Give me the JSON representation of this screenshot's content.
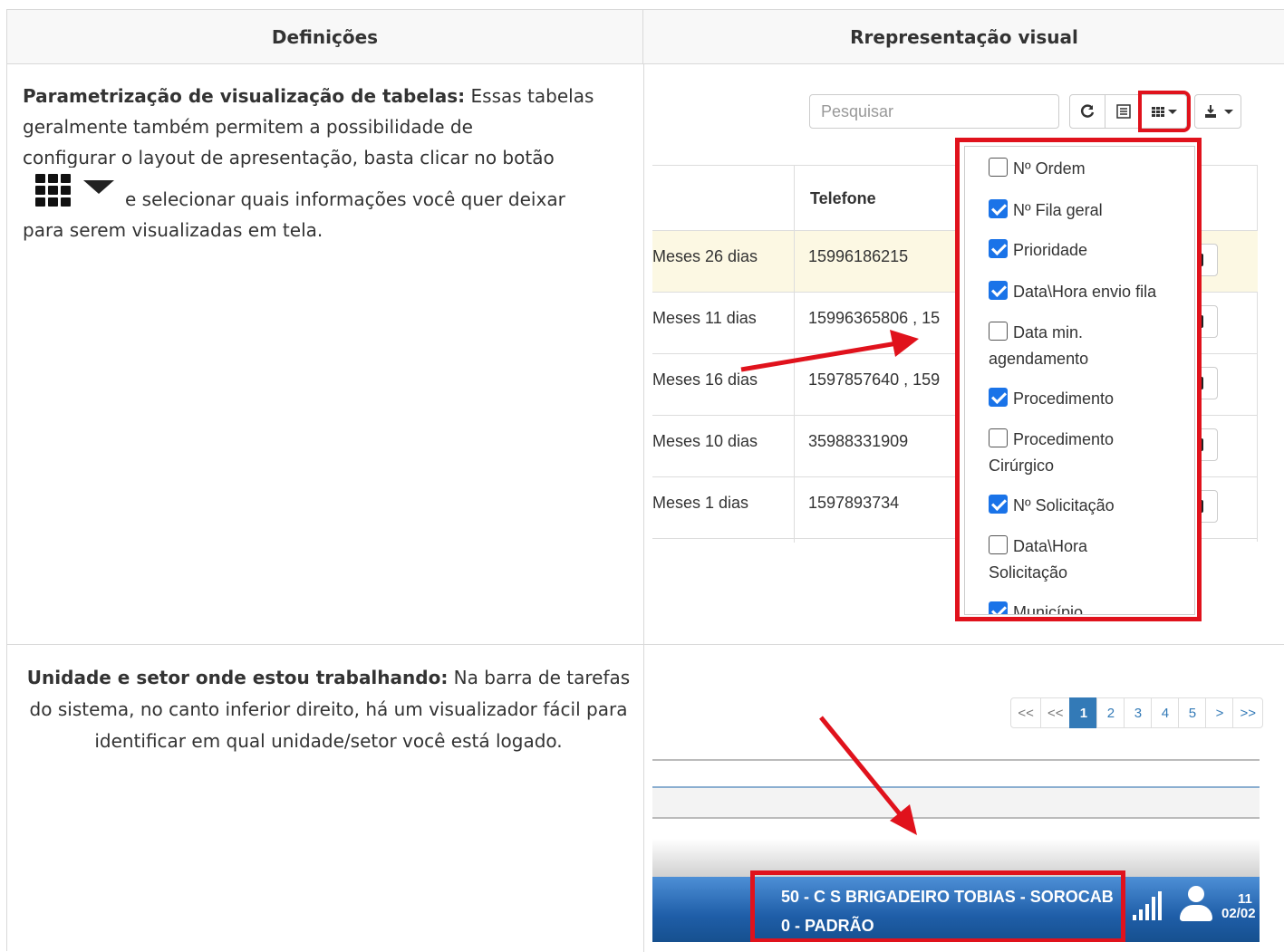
{
  "headers": {
    "definitions": "Definições",
    "visual": "Rrepresentação visual"
  },
  "row1": {
    "bold_title": "Parametrização de visualização de tabelas:",
    "text_a": " Essas tabelas geralmente também permitem a possibilidade de",
    "text_clipped": "configurar o layout de apresentação, basta clicar no botão",
    "text_b": "e selecionar quais informações você quer deixar",
    "text_c": "para serem visualizadas em tela.",
    "search_placeholder": "Pesquisar",
    "table": {
      "column_header": "Telefone",
      "rows": [
        {
          "c1": "Meses 26 dias",
          "c2": "15996186215",
          "highlight": true
        },
        {
          "c1": "Meses 11 dias",
          "c2": "15996365806 , 15",
          "highlight": false
        },
        {
          "c1": "Meses 16 dias",
          "c2": "1597857640 , 159",
          "highlight": false
        },
        {
          "c1": "Meses 10 dias",
          "c2": "35988331909",
          "highlight": false
        },
        {
          "c1": "Meses 1 dias",
          "c2": "1597893734",
          "highlight": false
        }
      ]
    },
    "column_options": [
      {
        "label": "Nº Ordem",
        "checked": false
      },
      {
        "label": "Nº Fila geral",
        "checked": true
      },
      {
        "label": "Prioridade",
        "checked": true
      },
      {
        "label": "Data\\Hora envio fila",
        "checked": true
      },
      {
        "label": "Data min.",
        "label2": "agendamento",
        "checked": false
      },
      {
        "label": "Procedimento",
        "checked": true
      },
      {
        "label": "Procedimento",
        "label2": "Cirúrgico",
        "checked": false
      },
      {
        "label": "Nº Solicitação",
        "checked": true
      },
      {
        "label": "Data\\Hora",
        "label2": "Solicitação",
        "checked": false
      },
      {
        "label": "Município",
        "checked": true
      }
    ],
    "icons": [
      "refresh-icon",
      "list-icon",
      "columns-grid-icon",
      "export-icon"
    ],
    "highlight_color": "#e0121c"
  },
  "row2": {
    "bold_title": "Unidade e setor onde estou trabalhando:",
    "text": " Na barra de tarefas do sistema, no canto inferior direito, há um visualizador fácil para identificar em qual unidade/setor você está logado.",
    "pagination": [
      "<<",
      "<<",
      "1",
      "2",
      "3",
      "4",
      "5",
      ">",
      ">>"
    ],
    "active_page": "1",
    "unit_line1": "50 - C S BRIGADEIRO TOBIAS - SOROCAB",
    "unit_line2": "0 - PADRÃO",
    "clock_time": "11",
    "clock_date": "02/02",
    "taskbar_color": "#1f5ea8"
  }
}
